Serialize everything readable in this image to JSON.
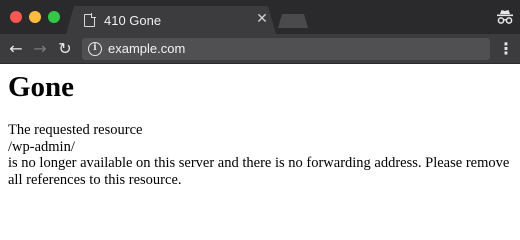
{
  "browser": {
    "tab": {
      "title": "410 Gone",
      "close_glyph": "✕"
    },
    "toolbar": {
      "back_glyph": "←",
      "forward_glyph": "→",
      "reload_glyph": "↻",
      "url": "example.com",
      "menu_glyph": "⋮"
    },
    "icons": {
      "tab_favicon": "page-icon",
      "omnibox": "info-icon",
      "profile": "incognito-icon"
    },
    "colors": {
      "close": "#fc5753",
      "minimize": "#fdbc40",
      "maximize": "#33c748",
      "frame": "#2a2a2c",
      "toolbar": "#3c3c3e"
    }
  },
  "page": {
    "heading": "Gone",
    "line1": "The requested resource",
    "path": "/wp-admin/",
    "message": "is no longer available on this server and there is no forwarding address. Please remove all references to this resource."
  }
}
